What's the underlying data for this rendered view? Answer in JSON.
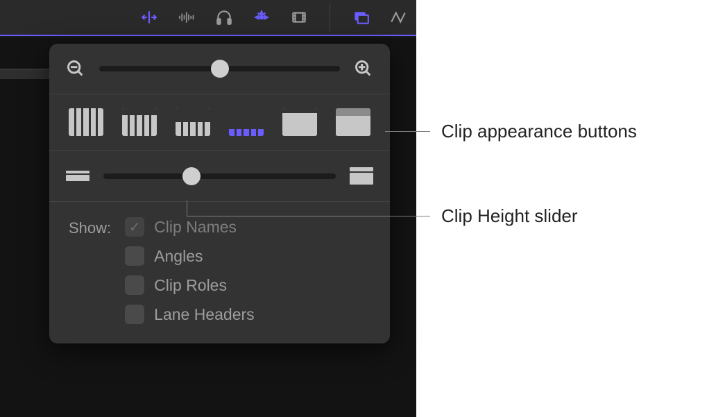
{
  "toolbar": {
    "icons": [
      {
        "name": "skimmer-icon",
        "active": true
      },
      {
        "name": "audio-waveform-icon",
        "active": false
      },
      {
        "name": "headphones-icon",
        "active": false
      },
      {
        "name": "snapping-icon",
        "active": true
      },
      {
        "name": "clip-appearance-icon",
        "active": false
      },
      {
        "name": "index-icon",
        "active": true
      },
      {
        "name": "effects-icon",
        "active": false
      }
    ],
    "divider_after_index": 5
  },
  "zoom_slider": {
    "value_percent": 50
  },
  "appearance_buttons": [
    {
      "name": "waveform-only",
      "top_band": 0,
      "stripes": true,
      "active": false
    },
    {
      "name": "waveform-large",
      "top_band": 10,
      "stripes": true,
      "active": false
    },
    {
      "name": "waveform-small-filmstrip",
      "top_band": 20,
      "stripes": true,
      "active": false
    },
    {
      "name": "filmstrip-large-waveform",
      "top_band": 30,
      "stripes": true,
      "active": true
    },
    {
      "name": "filmstrip-only",
      "top_band": 0,
      "stripes": false,
      "active": false
    },
    {
      "name": "filmstrip-labels",
      "top_band": 10,
      "stripes": false,
      "accent_top": true,
      "active": false
    }
  ],
  "height_slider": {
    "value_percent": 38
  },
  "show": {
    "label": "Show:",
    "options": [
      {
        "key": "clip_names",
        "label": "Clip Names",
        "checked": true,
        "disabled": true
      },
      {
        "key": "angles",
        "label": "Angles",
        "checked": false,
        "disabled": false
      },
      {
        "key": "clip_roles",
        "label": "Clip Roles",
        "checked": false,
        "disabled": false
      },
      {
        "key": "lane_headers",
        "label": "Lane Headers",
        "checked": false,
        "disabled": false
      }
    ]
  },
  "callouts": {
    "appearance": "Clip appearance buttons",
    "height": "Clip Height slider"
  }
}
